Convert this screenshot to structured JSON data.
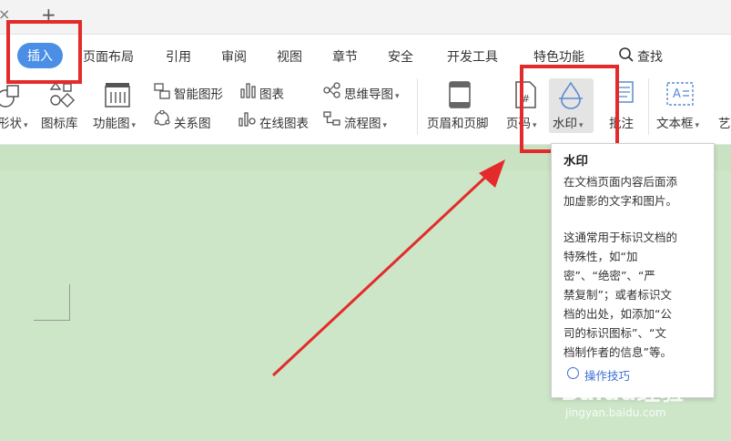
{
  "window": {
    "close_glyph": "×",
    "new_tab_glyph": "+"
  },
  "menu": {
    "tabs": [
      "插入",
      "页面布局",
      "引用",
      "审阅",
      "视图",
      "章节",
      "安全",
      "开发工具",
      "特色功能"
    ],
    "active_tab": "插入",
    "search_label": "查找"
  },
  "ribbon": {
    "shape_label": "形状",
    "icon_lib_label": "图标库",
    "func_chart_label": "功能图",
    "smart_art_label": "智能图形",
    "chart_label": "图表",
    "mindmap_label": "思维导图",
    "relation_label": "关系图",
    "online_chart_label": "在线图表",
    "flowchart_label": "流程图",
    "header_footer_label": "页眉和页脚",
    "page_num_label": "页码",
    "watermark_label": "水印",
    "comment_label": "批注",
    "textbox_label": "文本框",
    "wordart_label": "艺"
  },
  "tooltip": {
    "title": "水印",
    "desc1": [
      "在文档页面内容后面添",
      "加虚影的文字和图片。"
    ],
    "desc2": [
      "这通常用于标识文档的",
      "特殊性，如“加",
      "密”、“绝密”、“严",
      "禁复制”；或者标识文",
      "档的出处，如添加“公",
      "司的标识图标”、“文",
      "档制作者的信息”等。"
    ],
    "link": "操作技巧"
  },
  "watermark": {
    "brand": "Baidu经验",
    "url": "jingyan.baidu.com"
  },
  "colors": {
    "accent": "#4a8ee6",
    "highlight": "#e32b2b",
    "document_bg": "#cde6c8"
  }
}
